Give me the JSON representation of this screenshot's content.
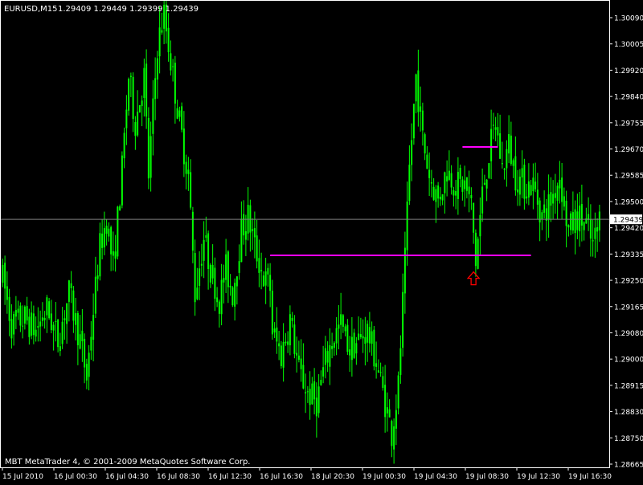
{
  "header": {
    "symbol": "EURUSD,M15",
    "ohlc": "1.29409 1.29449 1.29399 1.29439"
  },
  "footer": {
    "copyright": "MBT MetaTrader 4, © 2001-2009 MetaQuotes Software Corp."
  },
  "colors": {
    "background": "#000000",
    "candle": "#00FF00",
    "frame": "#FFFFFF",
    "bid_line": "#808080",
    "level_line": "#FF00FF",
    "arrow": "#FF0000"
  },
  "chart_data": {
    "type": "candlestick",
    "title": "",
    "xlabel": "",
    "ylabel": "",
    "ylim": [
      1.2864,
      1.3013
    ],
    "grid": false,
    "y_ticks": [
      "1.30090",
      "1.30005",
      "1.29920",
      "1.29840",
      "1.29755",
      "1.29670",
      "1.29585",
      "1.29500",
      "1.29420",
      "1.29335",
      "1.29250",
      "1.29165",
      "1.29080",
      "1.29000",
      "1.28915",
      "1.28830",
      "1.28750",
      "1.28665"
    ],
    "x_ticks": [
      "15 Jul 2010",
      "16 Jul 00:30",
      "16 Jul 04:30",
      "16 Jul 08:30",
      "16 Jul 12:30",
      "16 Jul 16:30",
      "18 Jul 20:30",
      "19 Jul 00:30",
      "19 Jul 04:30",
      "19 Jul 08:30",
      "19 Jul 12:30",
      "19 Jul 16:30"
    ],
    "current_price": "1.29439",
    "path_points": [
      [
        0,
        1.2925
      ],
      [
        4,
        1.291
      ],
      [
        10,
        1.2912
      ],
      [
        15,
        1.2908
      ],
      [
        20,
        1.2915
      ],
      [
        25,
        1.2905
      ],
      [
        30,
        1.292
      ],
      [
        35,
        1.2905
      ],
      [
        38,
        1.2893
      ],
      [
        41,
        1.2915
      ],
      [
        44,
        1.2935
      ],
      [
        47,
        1.2944
      ],
      [
        50,
        1.2928
      ],
      [
        54,
        1.296
      ],
      [
        57,
        1.299
      ],
      [
        60,
        1.2975
      ],
      [
        64,
        1.299
      ],
      [
        66,
        1.2958
      ],
      [
        70,
        1.3
      ],
      [
        73,
        1.301
      ],
      [
        76,
        1.2995
      ],
      [
        80,
        1.2975
      ],
      [
        84,
        1.2958
      ],
      [
        87,
        1.292
      ],
      [
        91,
        1.2938
      ],
      [
        94,
        1.2928
      ],
      [
        98,
        1.2918
      ],
      [
        101,
        1.2928
      ],
      [
        104,
        1.292
      ],
      [
        108,
        1.294
      ],
      [
        111,
        1.2945
      ],
      [
        114,
        1.2935
      ],
      [
        118,
        1.2925
      ],
      [
        121,
        1.2922
      ],
      [
        122,
        1.2908
      ],
      [
        126,
        1.29
      ],
      [
        130,
        1.2912
      ],
      [
        134,
        1.2895
      ],
      [
        138,
        1.2888
      ],
      [
        142,
        1.2885
      ],
      [
        146,
        1.2898
      ],
      [
        149,
        1.2905
      ],
      [
        153,
        1.291
      ],
      [
        157,
        1.2902
      ],
      [
        161,
        1.2905
      ],
      [
        165,
        1.2908
      ],
      [
        169,
        1.2898
      ],
      [
        173,
        1.2885
      ],
      [
        176,
        1.2875
      ],
      [
        179,
        1.289
      ],
      [
        182,
        1.293
      ],
      [
        184,
        1.296
      ],
      [
        187,
        1.299
      ],
      [
        190,
        1.297
      ],
      [
        193,
        1.2958
      ],
      [
        197,
        1.295
      ],
      [
        201,
        1.296
      ],
      [
        205,
        1.2955
      ],
      [
        209,
        1.2955
      ],
      [
        212,
        1.2948
      ],
      [
        214,
        1.293
      ],
      [
        217,
        1.2952
      ],
      [
        220,
        1.2965
      ],
      [
        223,
        1.2975
      ],
      [
        226,
        1.296
      ],
      [
        229,
        1.2968
      ],
      [
        232,
        1.2958
      ],
      [
        236,
        1.2955
      ],
      [
        240,
        1.2955
      ],
      [
        244,
        1.2945
      ],
      [
        248,
        1.295
      ],
      [
        252,
        1.2958
      ],
      [
        256,
        1.294
      ],
      [
        260,
        1.2945
      ],
      [
        264,
        1.2942
      ],
      [
        267,
        1.2935
      ],
      [
        270,
        1.2944
      ]
    ],
    "lines": [
      {
        "name": "",
        "style": "horizontal",
        "price": 1.29323,
        "from_bar": 121,
        "to_bar": 239
      },
      {
        "name": "",
        "style": "horizontal",
        "price": 1.29672,
        "from_bar": 208,
        "to_bar": 224
      }
    ],
    "markers": [
      {
        "type": "up-arrow",
        "bar": 213,
        "price": 1.29285
      }
    ]
  }
}
